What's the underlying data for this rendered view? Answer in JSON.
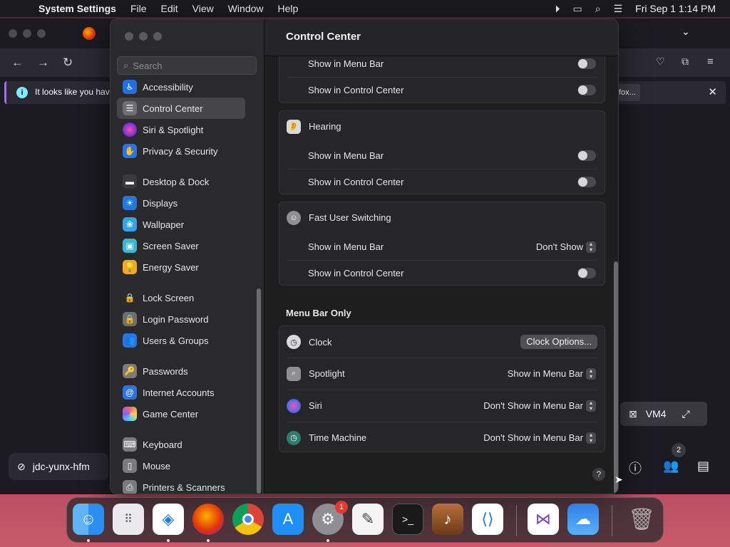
{
  "menubar": {
    "app_name": "System Settings",
    "items": [
      "File",
      "Edit",
      "View",
      "Window",
      "Help"
    ],
    "clock": "Fri Sep 1  1:14 PM"
  },
  "browser": {
    "info_text": "It looks like you have",
    "info_button": "fox...",
    "left_pill_label": "jdc-yunx-hfm",
    "vm_label": "VM4",
    "participants_badge": "2"
  },
  "sidebar": {
    "search_placeholder": "Search",
    "items": [
      {
        "label": "Accessibility",
        "icon": "accessibility-icon",
        "color": "#1f6fe5"
      },
      {
        "label": "Control Center",
        "icon": "control-center-icon",
        "color": "#6e6e73"
      },
      {
        "label": "Siri & Spotlight",
        "icon": "siri-icon",
        "color": "#8a3fd6"
      },
      {
        "label": "Privacy & Security",
        "icon": "hand-icon",
        "color": "#2a74e8"
      },
      {
        "label": "Desktop & Dock",
        "icon": "dock-icon",
        "color": "#3a3a3c"
      },
      {
        "label": "Displays",
        "icon": "sun-icon",
        "color": "#1f7ae0"
      },
      {
        "label": "Wallpaper",
        "icon": "wallpaper-icon",
        "color": "#35a4e6"
      },
      {
        "label": "Screen Saver",
        "icon": "screen-saver-icon",
        "color": "#3cb3d9"
      },
      {
        "label": "Energy Saver",
        "icon": "bulb-icon",
        "color": "#f5a623"
      },
      {
        "label": "Lock Screen",
        "icon": "lock-icon",
        "color": "#2c2c2e"
      },
      {
        "label": "Login Password",
        "icon": "key-lock-icon",
        "color": "#6e6e73"
      },
      {
        "label": "Users & Groups",
        "icon": "users-icon",
        "color": "#2a74e8"
      },
      {
        "label": "Passwords",
        "icon": "key-icon",
        "color": "#7a7a7f"
      },
      {
        "label": "Internet Accounts",
        "icon": "at-icon",
        "color": "#2a74e8"
      },
      {
        "label": "Game Center",
        "icon": "game-center-icon",
        "color": "#d94c8a"
      },
      {
        "label": "Keyboard",
        "icon": "keyboard-icon",
        "color": "#7a7a7f"
      },
      {
        "label": "Mouse",
        "icon": "mouse-icon",
        "color": "#7a7a7f"
      },
      {
        "label": "Printers & Scanners",
        "icon": "printer-icon",
        "color": "#7a7a7f"
      }
    ]
  },
  "main": {
    "title": "Control Center",
    "top_rows": {
      "show_menu_bar": "Show in Menu Bar",
      "show_control_center": "Show in Control Center"
    },
    "hearing": {
      "title": "Hearing",
      "show_menu_bar": "Show in Menu Bar",
      "show_control_center": "Show in Control Center"
    },
    "fast_user": {
      "title": "Fast User Switching",
      "show_menu_bar": "Show in Menu Bar",
      "menu_bar_value": "Don't Show",
      "show_control_center": "Show in Control Center"
    },
    "menu_bar_only": {
      "section_title": "Menu Bar Only",
      "clock": "Clock",
      "clock_button": "Clock Options...",
      "spotlight": "Spotlight",
      "spotlight_value": "Show in Menu Bar",
      "siri": "Siri",
      "siri_value": "Don't Show in Menu Bar",
      "time_machine": "Time Machine",
      "time_machine_value": "Don't Show in Menu Bar"
    },
    "help": "?"
  },
  "dock": {
    "settings_badge": "1",
    "apps": [
      "finder-icon",
      "launchpad-icon",
      "safari-icon",
      "firefox-icon",
      "chrome-icon",
      "app-store-icon",
      "system-settings-icon",
      "textedit-icon",
      "terminal-icon",
      "garageband-icon",
      "vscode-icon",
      "visual-studio-icon",
      "weather-icon",
      "trash-icon"
    ]
  }
}
